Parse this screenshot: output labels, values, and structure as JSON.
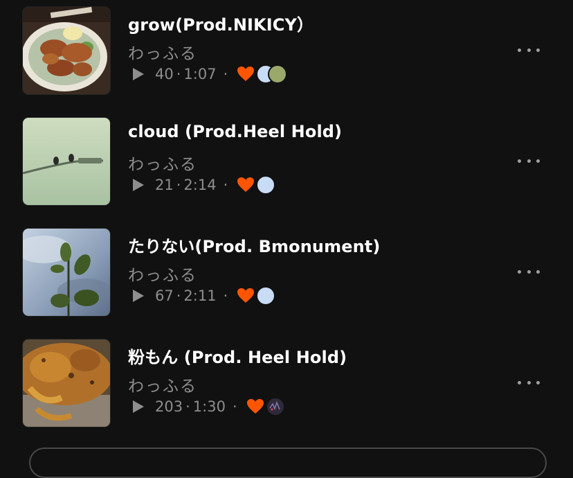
{
  "tracks": [
    {
      "title": "grow(Prod.NIKICY）",
      "artist": "わっふる",
      "plays": "40",
      "duration": "1:07",
      "artwork": "fried-chicken-plate",
      "liked": true,
      "avatars": [
        "light-blue",
        "green-photo"
      ]
    },
    {
      "title": "cloud (Prod.Heel Hold)",
      "artist": "わっふる",
      "plays": "21",
      "duration": "2:14",
      "artwork": "birds-on-pole-sky",
      "liked": true,
      "avatars": [
        "light-blue"
      ]
    },
    {
      "title": "たりない(Prod. Bmonument)",
      "artist": "わっふる",
      "plays": "67",
      "duration": "2:11",
      "artwork": "leaves-against-sky",
      "liked": true,
      "avatars": [
        "light-blue"
      ]
    },
    {
      "title": "粉もん (Prod. Heel Hold)",
      "artist": "わっふる",
      "plays": "203",
      "duration": "1:30",
      "artwork": "okonomiyaki",
      "liked": true,
      "avatars": [
        "dark-pattern"
      ]
    }
  ],
  "icons": {
    "play": "play-icon",
    "like": "heart-icon",
    "more": "more-icon"
  },
  "colors": {
    "background": "#111111",
    "heart": "#ff5500",
    "secondary_text": "#8e8e8e"
  },
  "separator": "·"
}
